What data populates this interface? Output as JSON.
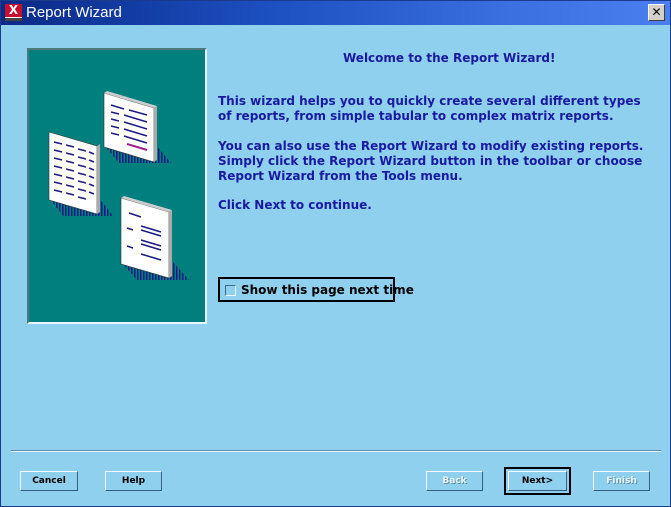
{
  "window": {
    "title": "Report Wizard",
    "close_glyph": "✕"
  },
  "app_icon": {
    "glyph": "X"
  },
  "content": {
    "heading": "Welcome to the Report Wizard!",
    "paragraph1": "This wizard helps you to quickly create several different types of reports, from simple tabular to complex matrix reports.",
    "paragraph2": "You can also use the Report Wizard to modify existing reports. Simply click the Report Wizard button in the toolbar or choose Report Wizard from the Tools menu.",
    "paragraph3": "Click Next to continue."
  },
  "show_page_checkbox": {
    "label": "Show this page next time",
    "checked": false
  },
  "buttons": {
    "cancel": "Cancel",
    "help": "Help",
    "back": "Back",
    "next": "Next>",
    "finish": "Finish"
  },
  "colors": {
    "background": "#8fd0ee",
    "illustration_bg": "#007f7f",
    "text": "#1a1aa0",
    "titlebar": "#0a2a86"
  }
}
